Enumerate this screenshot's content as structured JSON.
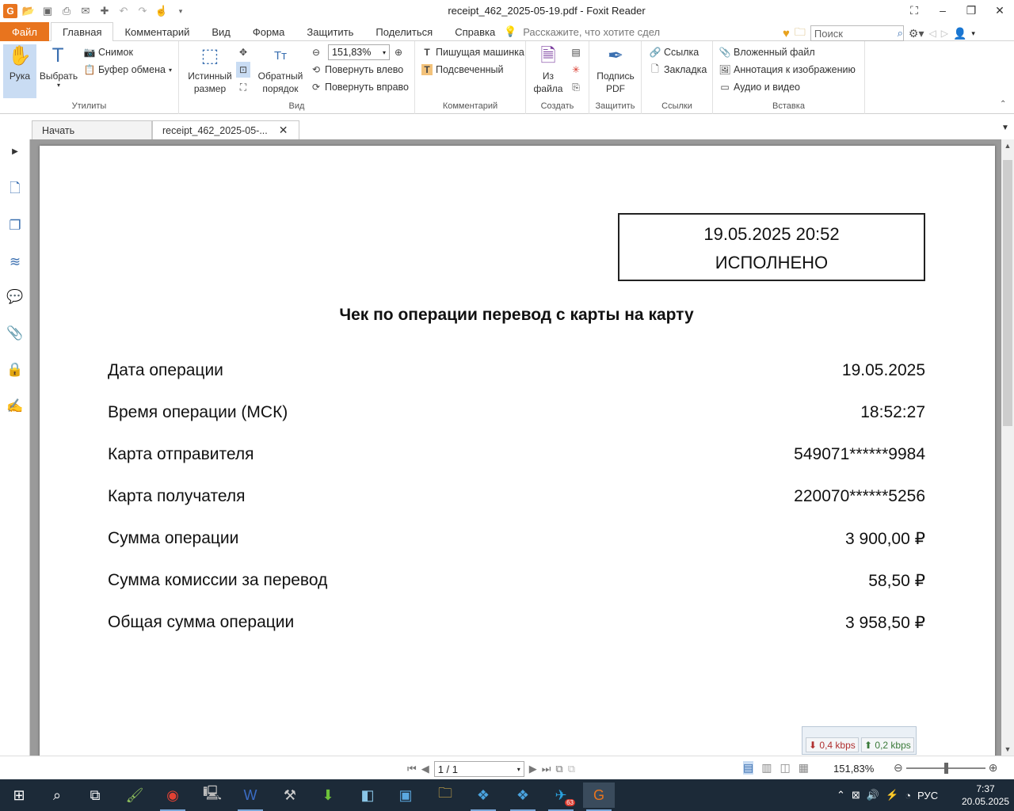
{
  "window": {
    "title": "receipt_462_2025-05-19.pdf - Foxit Reader",
    "logo_letter": "G"
  },
  "quick_access": [
    "open-icon",
    "save-icon",
    "print-icon",
    "email-icon",
    "new-icon",
    "undo-icon",
    "redo-icon",
    "hand-icon",
    "customize-icon"
  ],
  "menu": {
    "file": "Файл",
    "tabs": [
      "Главная",
      "Комментарий",
      "Вид",
      "Форма",
      "Защитить",
      "Поделиться",
      "Справка"
    ],
    "active_tab": "Главная",
    "tell_me": "Расскажите, что хотите сдел",
    "search_placeholder": "Поиск"
  },
  "ribbon": {
    "utilities": {
      "label": "Утилиты",
      "hand": "Рука",
      "select": "Выбрать",
      "snapshot": "Снимок",
      "clipboard": "Буфер обмена"
    },
    "view": {
      "label": "Вид",
      "actual_size_1": "Истинный",
      "actual_size_2": "размер",
      "reverse_order_1": "Обратный",
      "reverse_order_2": "порядок",
      "zoom_value": "151,83%",
      "rotate_left": "Повернуть влево",
      "rotate_right": "Повернуть вправо"
    },
    "comment": {
      "label": "Комментарий",
      "typewriter": "Пишущая машинка",
      "highlight": "Подсвеченный"
    },
    "create": {
      "label": "Создать",
      "from_file_1": "Из",
      "from_file_2": "файла"
    },
    "protect": {
      "label": "Защитить",
      "sign_1": "Подпись",
      "sign_2": "PDF"
    },
    "links": {
      "label": "Ссылки",
      "link": "Ссылка",
      "bookmark": "Закладка"
    },
    "insert": {
      "label": "Вставка",
      "attachment": "Вложенный файл",
      "image_annotation": "Аннотация к изображению",
      "audio_video": "Аудио и видео"
    }
  },
  "doc_tabs": {
    "start": "Начать",
    "current": "receipt_462_2025-05-..."
  },
  "receipt": {
    "datetime": "19.05.2025 20:52",
    "status": "ИСПОЛНЕНО",
    "title": "Чек по операции перевод с карты на карту",
    "rows": [
      {
        "label": "Дата операции",
        "value": "19.05.2025"
      },
      {
        "label": "Время операции (МСК)",
        "value": "18:52:27"
      },
      {
        "label": "Карта отправителя",
        "value": "549071******9984"
      },
      {
        "label": "Карта получателя",
        "value": "220070******5256"
      },
      {
        "label": "Сумма операции",
        "value": "3 900,00 ₽"
      },
      {
        "label": "Сумма комиссии за перевод",
        "value": "58,50 ₽"
      },
      {
        "label": "Общая сумма операции",
        "value": "3 958,50 ₽"
      }
    ]
  },
  "statusbar": {
    "page": "1 / 1",
    "zoom": "151,83%"
  },
  "network": {
    "down": "0,4 kbps",
    "up": "0,2 kbps"
  },
  "taskbar": {
    "telegram_badge": "63",
    "lang": "РУС",
    "time": "7:37",
    "date": "20.05.2025"
  },
  "colors": {
    "accent": "#e8741e",
    "selected": "#c9dcf3",
    "doc_bg": "#9a9a9a",
    "taskbar": "#1c2a38"
  }
}
